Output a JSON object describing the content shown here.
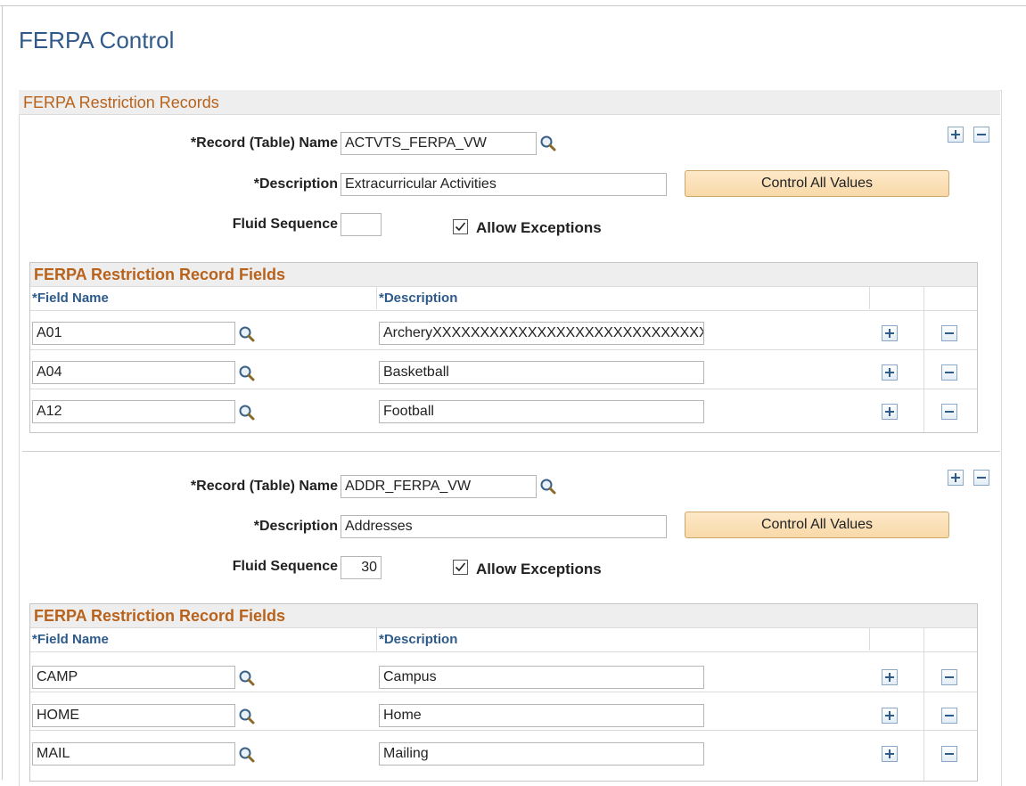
{
  "page": {
    "title": "FERPA Control"
  },
  "section": {
    "title": "FERPA Restriction Records"
  },
  "labels": {
    "record_name": "*Record (Table) Name",
    "description": "*Description",
    "fluid_sequence": "Fluid Sequence",
    "allow_exceptions": "Allow Exceptions",
    "control_all_values": "Control All Values",
    "grid_title": "FERPA Restriction Record Fields",
    "col_field_name": "*Field Name",
    "col_description": "*Description"
  },
  "records": [
    {
      "record_name": "ACTVTS_FERPA_VW",
      "description": "Extracurricular Activities",
      "fluid_sequence": "",
      "allow_exceptions": true,
      "fields": [
        {
          "field_name": "A01",
          "description": "ArcheryXXXXXXXXXXXXXXXXXXXXXXXXXXXXXX"
        },
        {
          "field_name": "A04",
          "description": "Basketball"
        },
        {
          "field_name": "A12",
          "description": "Football"
        }
      ]
    },
    {
      "record_name": "ADDR_FERPA_VW",
      "description": "Addresses",
      "fluid_sequence": "30",
      "allow_exceptions": true,
      "fields": [
        {
          "field_name": "CAMP",
          "description": "Campus"
        },
        {
          "field_name": "HOME",
          "description": "Home"
        },
        {
          "field_name": "MAIL",
          "description": "Mailing"
        }
      ]
    }
  ]
}
